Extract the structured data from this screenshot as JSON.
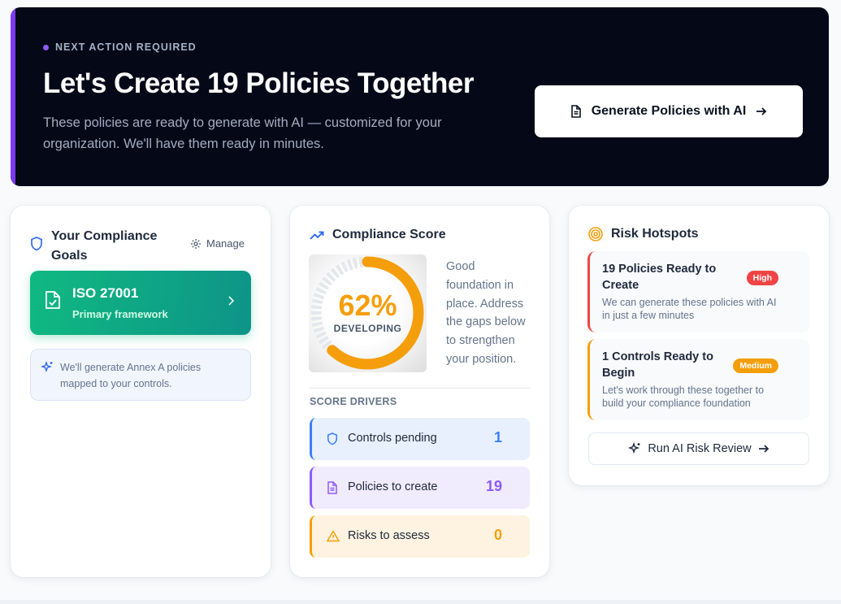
{
  "hero": {
    "eyebrow": "NEXT ACTION REQUIRED",
    "title": "Let's Create 19 Policies Together",
    "subtitle": "These policies are ready to generate with AI — customized for your organization. We'll have them ready in minutes.",
    "button_label": "Generate Policies with AI",
    "button_icon": "document-icon",
    "accent_color": "#7c3aed"
  },
  "goals": {
    "title": "Your Compliance Goals",
    "title_icon": "shield-icon",
    "manage_label": "Manage",
    "framework": {
      "name": "ISO 27001",
      "subtitle": "Primary framework",
      "color": "#10b981"
    },
    "note": "We'll generate Annex A policies mapped to your controls."
  },
  "score": {
    "title": "Compliance Score",
    "title_icon": "trending-up-icon",
    "value_text": "62%",
    "value": 62,
    "level": "DEVELOPING",
    "description": "Good foundation in place. Address the gaps below to strengthen your position.",
    "gauge_color": "#f59e0b",
    "drivers_title": "SCORE DRIVERS",
    "drivers": [
      {
        "label": "Controls pending",
        "count": "1",
        "icon": "shield-icon",
        "color": "#3b82f6"
      },
      {
        "label": "Policies to create",
        "count": "19",
        "icon": "document-icon",
        "color": "#8b5cf6"
      },
      {
        "label": "Risks to assess",
        "count": "0",
        "icon": "warning-icon",
        "color": "#f59e0b"
      }
    ]
  },
  "risk": {
    "title": "Risk Hotspots",
    "title_icon": "target-icon",
    "items": [
      {
        "title": "19 Policies Ready to Create",
        "badge": "High",
        "description": "We can generate these policies with AI in just a few minutes",
        "color": "#ef4444"
      },
      {
        "title": "1 Controls Ready to Begin",
        "badge": "Medium",
        "description": "Let's work through these together to build your compliance foundation",
        "color": "#f59e0b"
      }
    ],
    "button_label": "Run AI Risk Review"
  }
}
